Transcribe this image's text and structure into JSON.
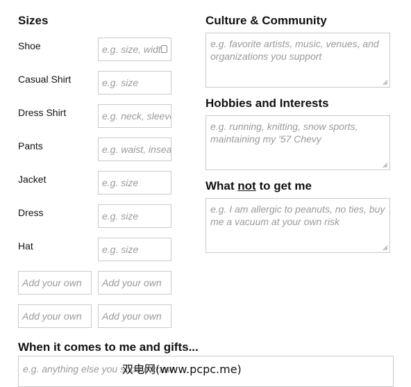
{
  "sizes": {
    "heading": "Sizes",
    "rows": [
      {
        "label": "Shoe",
        "placeholder": "e.g. size, width"
      },
      {
        "label": "Casual Shirt",
        "placeholder": "e.g. size"
      },
      {
        "label": "Dress Shirt",
        "placeholder": "e.g. neck, sleeve"
      },
      {
        "label": "Pants",
        "placeholder": "e.g. waist, inseam"
      },
      {
        "label": "Jacket",
        "placeholder": "e.g. size"
      },
      {
        "label": "Dress",
        "placeholder": "e.g. size"
      },
      {
        "label": "Hat",
        "placeholder": "e.g. size"
      }
    ],
    "custom_rows": [
      {
        "label_placeholder": "Add your own",
        "value_placeholder": "Add your own"
      },
      {
        "label_placeholder": "Add your own",
        "value_placeholder": "Add your own"
      }
    ]
  },
  "culture": {
    "heading": "Culture & Community",
    "placeholder": "e.g. favorite artists, music, venues, and organizations you support"
  },
  "hobbies": {
    "heading": "Hobbies and Interests",
    "placeholder": "e.g. running, knitting, snow sports, maintaining my '57 Chevy"
  },
  "not_to_get": {
    "heading_pre": "What ",
    "heading_emph": "not",
    "heading_post": " to get me",
    "placeholder": "e.g. I am allergic to peanuts, no ties, buy me a vacuum at your own risk"
  },
  "gifts": {
    "heading": "When it comes to me and gifts...",
    "placeholder": "e.g. anything else you should know"
  },
  "watermark": "双电网(www.pcpc.me)"
}
